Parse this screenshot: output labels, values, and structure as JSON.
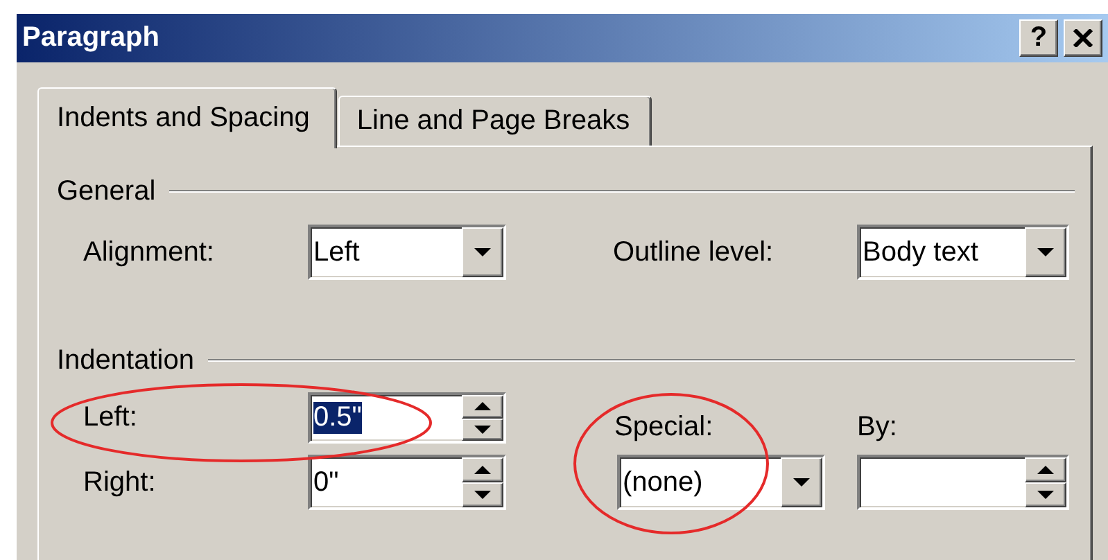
{
  "window": {
    "title": "Paragraph",
    "help_button": "?"
  },
  "tabs": [
    {
      "label": "Indents and Spacing",
      "selected": true
    },
    {
      "label": "Line and Page Breaks",
      "selected": false
    }
  ],
  "general": {
    "heading": "General",
    "alignment": {
      "label": "Alignment:",
      "value": "Left"
    },
    "outline_level": {
      "label": "Outline level:",
      "value": "Body text"
    }
  },
  "indentation": {
    "heading": "Indentation",
    "left": {
      "label": "Left:",
      "value": "0.5\"",
      "selected": true,
      "circled": true
    },
    "right": {
      "label": "Right:",
      "value": "0\"",
      "selected": false,
      "circled": false
    },
    "special": {
      "label": "Special:",
      "value": "(none)",
      "circled": true
    },
    "by": {
      "label": "By:",
      "selected": false,
      "circled": false
    }
  }
}
